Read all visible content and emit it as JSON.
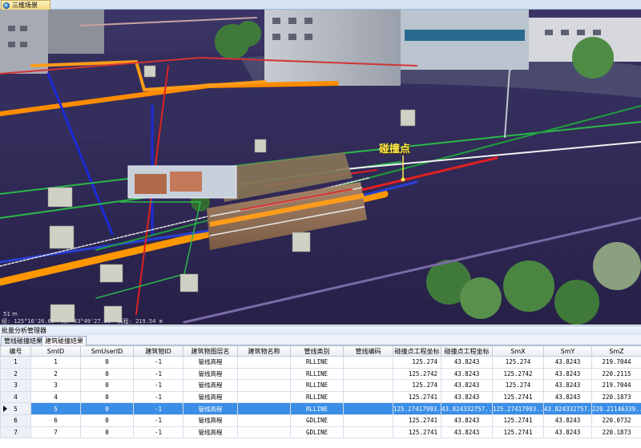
{
  "window": {
    "doc_tab_title": "三维场景"
  },
  "scene": {
    "collision_label": "碰撞点",
    "status_text": "经: 125°16'26.66\"  纬: 43°49'27.30\"  高程: 219.54 m",
    "scale_text": "51 m"
  },
  "panel": {
    "title": "批量分析管理器",
    "tabs": [
      {
        "label": "管线碰撞结果",
        "active": false
      },
      {
        "label": "建筑碰撞结果",
        "active": true
      }
    ]
  },
  "grid": {
    "columns": [
      "编号",
      "SmID",
      "SmUserID",
      "建筑物ID",
      "建筑物图层名",
      "建筑物名称",
      "管线类别",
      "管线编码",
      "碰撞点工程坐标",
      "碰撞点工程坐标",
      "SmX",
      "SmY",
      "SmZ"
    ],
    "rows": [
      {
        "no": "1",
        "smid": "1",
        "smuserid": "0",
        "bid": "-1",
        "layer": "管线高程",
        "name": "",
        "type": "RLLINE",
        "code": "",
        "cx": "125.274",
        "cy": "43.8243",
        "smx": "125.274",
        "smy": "43.8243",
        "smz": "219.7044",
        "selected": false
      },
      {
        "no": "2",
        "smid": "2",
        "smuserid": "0",
        "bid": "-1",
        "layer": "管线高程",
        "name": "",
        "type": "RLLINE",
        "code": "",
        "cx": "125.2742",
        "cy": "43.8243",
        "smx": "125.2742",
        "smy": "43.8243",
        "smz": "220.2115",
        "selected": false
      },
      {
        "no": "3",
        "smid": "3",
        "smuserid": "0",
        "bid": "-1",
        "layer": "管线高程",
        "name": "",
        "type": "RLLINE",
        "code": "",
        "cx": "125.274",
        "cy": "43.8243",
        "smx": "125.274",
        "smy": "43.8243",
        "smz": "219.7044",
        "selected": false
      },
      {
        "no": "4",
        "smid": "4",
        "smuserid": "0",
        "bid": "-1",
        "layer": "管线高程",
        "name": "",
        "type": "RLLINE",
        "code": "",
        "cx": "125.2741",
        "cy": "43.8243",
        "smx": "125.2741",
        "smy": "43.8243",
        "smz": "220.1873",
        "selected": false
      },
      {
        "no": "5",
        "smid": "5",
        "smuserid": "0",
        "bid": "-1",
        "layer": "管线高程",
        "name": "",
        "type": "RLLINE",
        "code": "",
        "cx": "125.27417993...",
        "cy": "43.824332757...",
        "smx": "125.27417993...",
        "smy": "43.824332757...",
        "smz": "220.21146339...",
        "selected": true
      },
      {
        "no": "6",
        "smid": "6",
        "smuserid": "0",
        "bid": "-1",
        "layer": "管线高程",
        "name": "",
        "type": "GDLINE",
        "code": "",
        "cx": "125.2741",
        "cy": "43.8243",
        "smx": "125.2741",
        "smy": "43.8243",
        "smz": "220.0732",
        "selected": false
      },
      {
        "no": "7",
        "smid": "7",
        "smuserid": "0",
        "bid": "-1",
        "layer": "管线高程",
        "name": "",
        "type": "GDLINE",
        "code": "",
        "cx": "125.2741",
        "cy": "43.8243",
        "smx": "125.2741",
        "smy": "43.8243",
        "smz": "220.1873",
        "selected": false
      }
    ]
  }
}
